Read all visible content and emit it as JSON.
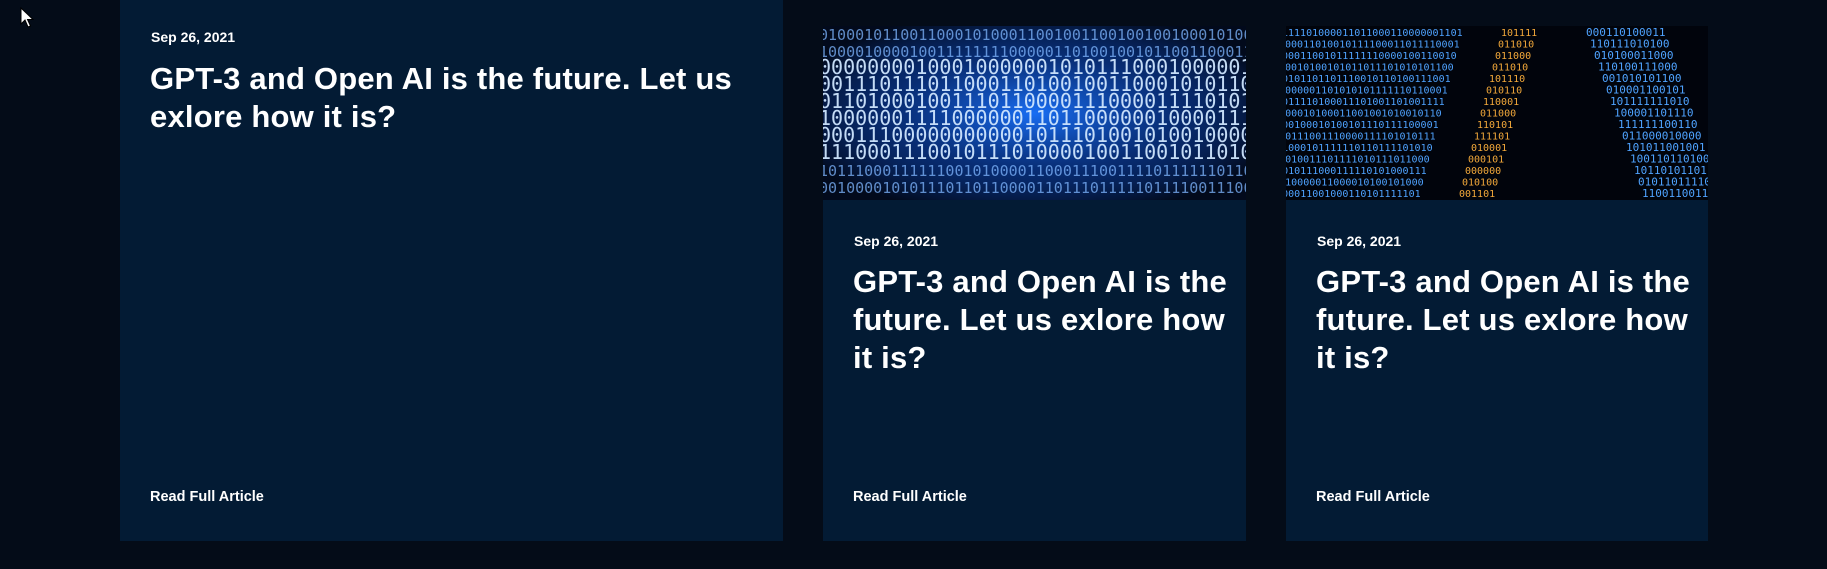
{
  "articles": [
    {
      "date": "Sep 26, 2021",
      "title": "GPT-3 and Open AI is the future. Let us exlore how it is?",
      "link_label": "Read Full Article",
      "image": ""
    },
    {
      "date": "Sep 26, 2021",
      "title": "GPT-3 and Open AI is the future. Let us exlore how it is?",
      "link_label": "Read Full Article",
      "image": "binary-code-blue"
    },
    {
      "date": "Sep 26, 2021",
      "title": "GPT-3 and Open AI is the future. Let us exlore how it is?",
      "link_label": "Read Full Article",
      "image": "binary-code-blue-orange"
    }
  ],
  "colors": {
    "page_background": "#040c18",
    "card_background": "#031b34",
    "text": "#ffffff",
    "binary_blue": "#2f8fff",
    "binary_orange": "#f0a030"
  },
  "icons": {
    "cursor": "mouse-pointer-icon"
  }
}
